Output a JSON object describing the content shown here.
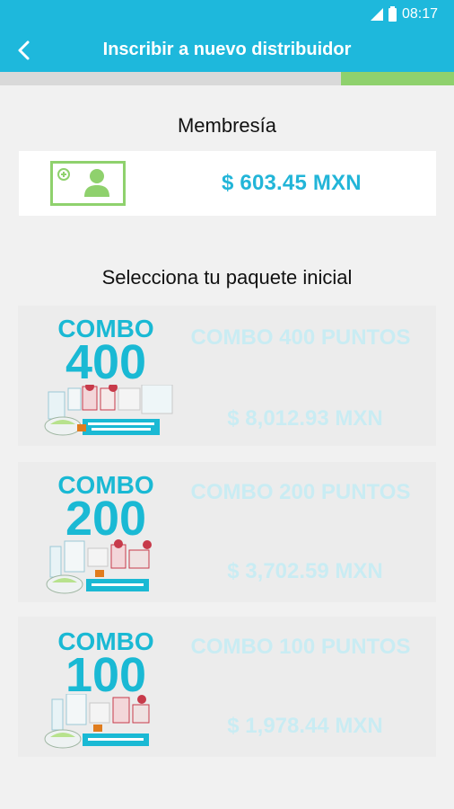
{
  "status": {
    "time": "08:17"
  },
  "header": {
    "title": "Inscribir a nuevo distribuidor"
  },
  "progress": {
    "fraction": 0.25
  },
  "membership": {
    "label": "Membresía",
    "price": "$ 603.45 MXN",
    "icon": "id-card-icon"
  },
  "packages": {
    "label": "Selecciona tu paquete inicial",
    "items": [
      {
        "badge_word": "COMBO",
        "badge_number": "400",
        "name": "COMBO 400 PUNTOS",
        "price": "$ 8,012.93 MXN"
      },
      {
        "badge_word": "COMBO",
        "badge_number": "200",
        "name": "COMBO 200 PUNTOS",
        "price": "$ 3,702.59 MXN"
      },
      {
        "badge_word": "COMBO",
        "badge_number": "100",
        "name": "COMBO 100 PUNTOS",
        "price": "$ 1,978.44 MXN"
      }
    ]
  },
  "colors": {
    "accent": "#1eb8dc",
    "progress": "#8fd16d",
    "inactive_text": "#c9ecf3"
  }
}
